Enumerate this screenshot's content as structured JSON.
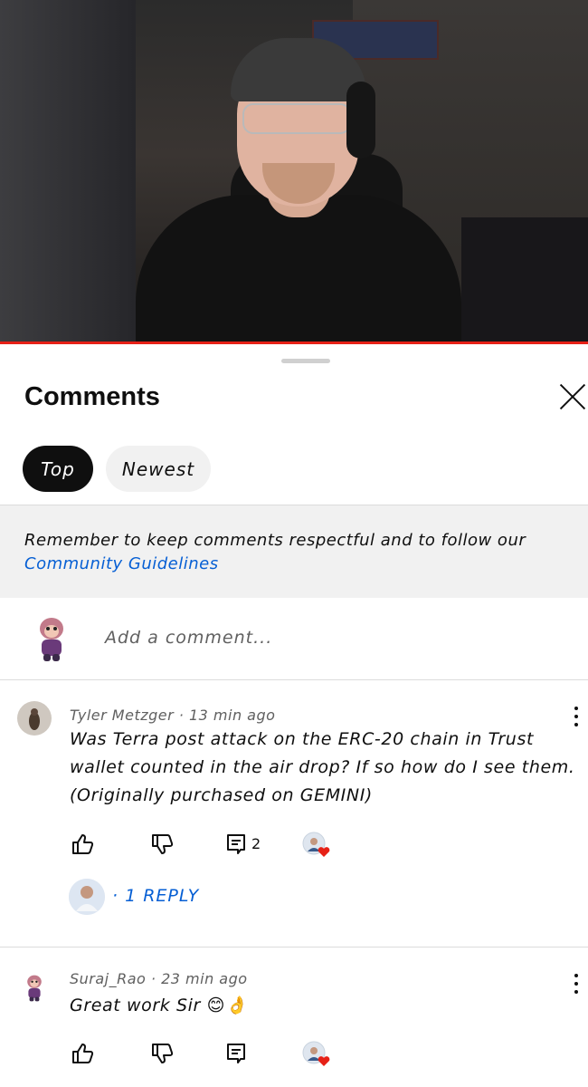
{
  "sheet": {
    "title": "Comments",
    "close_icon": "close-icon"
  },
  "tabs": [
    {
      "label": "Top",
      "active": true
    },
    {
      "label": "Newest",
      "active": false
    }
  ],
  "guideline": {
    "text": "Remember to keep comments respectful and to follow our",
    "link": "Community Guidelines"
  },
  "add_comment": {
    "placeholder": "Add a comment..."
  },
  "comments": [
    {
      "meta": "Tyler Metzger · 13 min ago",
      "text": "Was Terra post attack on the ERC-20 chain in Trust wallet counted in the air drop? If so how do I see them. (Originally purchased on GEMINI)",
      "reply_count": "2",
      "replies_label": "· 1 REPLY"
    },
    {
      "meta": "Suraj_Rao · 23 min ago",
      "text": "Great work Sir 😊👌",
      "reply_count": ""
    }
  ],
  "colors": {
    "accent": "#065fd4",
    "progress": "#e62117",
    "heart": "#e62117"
  }
}
